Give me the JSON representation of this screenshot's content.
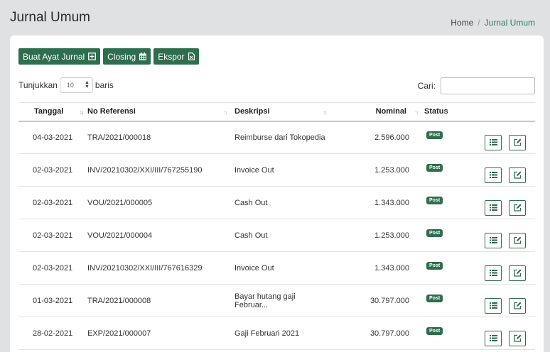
{
  "page": {
    "title": "Jurnal Umum"
  },
  "breadcrumb": {
    "home": "Home",
    "separator": "/",
    "current": "Jurnal Umum"
  },
  "toolbar": {
    "create_label": "Buat Ayat Jurnal",
    "closing_label": "Closing",
    "export_label": "Ekspor"
  },
  "length_menu": {
    "prefix": "Tunjukkan",
    "value": "10",
    "suffix": "baris"
  },
  "search": {
    "label": "Cari:",
    "value": ""
  },
  "table": {
    "headers": {
      "date": "Tanggal",
      "ref": "No Referensi",
      "desc": "Deskripsi",
      "nominal": "Nominal",
      "status": "Status"
    },
    "rows": [
      {
        "date": "04-03-2021",
        "ref": "TRA/2021/000018",
        "desc": "Reimburse dari Tokopedia",
        "nominal": "2.596.000",
        "status": "Post"
      },
      {
        "date": "02-03-2021",
        "ref": "INV/20210302/XXI/III/767255190",
        "desc": "Invoice Out",
        "nominal": "1.253.000",
        "status": "Post"
      },
      {
        "date": "02-03-2021",
        "ref": "VOU/2021/000005",
        "desc": "Cash Out",
        "nominal": "1.343.000",
        "status": "Post"
      },
      {
        "date": "02-03-2021",
        "ref": "VOU/2021/000004",
        "desc": "Cash Out",
        "nominal": "1.253.000",
        "status": "Post"
      },
      {
        "date": "02-03-2021",
        "ref": "INV/20210302/XXI/III/767616329",
        "desc": "Invoice Out",
        "nominal": "1.343.000",
        "status": "Post"
      },
      {
        "date": "01-03-2021",
        "ref": "TRA/2021/000008",
        "desc": "Bayar hutang gaji Februar...",
        "nominal": "30.797.000",
        "status": "Post"
      },
      {
        "date": "28-02-2021",
        "ref": "EXP/2021/000007",
        "desc": "Gaji Februari 2021",
        "nominal": "30.797.000",
        "status": "Post"
      }
    ]
  },
  "colors": {
    "accent": "#2e6d4e",
    "page_bg": "#dfe1e3",
    "breadcrumb_active": "#2e7d5b"
  }
}
